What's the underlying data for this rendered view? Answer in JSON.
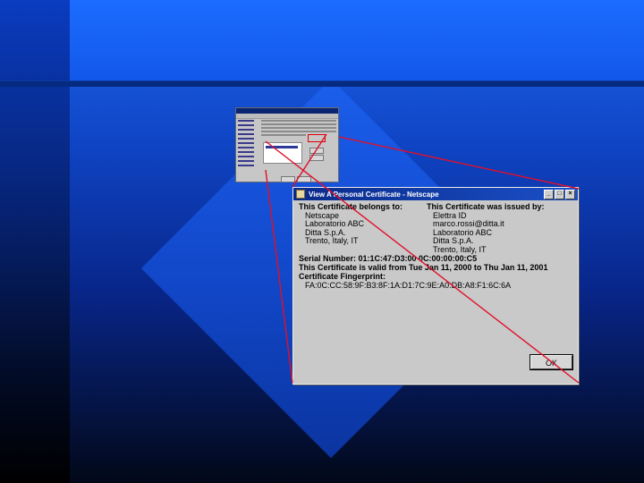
{
  "colors": {
    "accent_line": "#e0102a",
    "titlebar": "#0a2a8a",
    "dialog_bg": "#c9c9c9"
  },
  "dialog": {
    "title": "View A Personal Certificate - Netscape",
    "belongs_heading": "This Certificate belongs to:",
    "belongs_lines": [
      "Netscape",
      "Laboratorio ABC",
      "Ditta S.p.A.",
      "Trento, Italy, IT"
    ],
    "issued_heading": "This Certificate was issued by:",
    "issued_lines": [
      "Elettra ID",
      "marco.rossi@ditta.it",
      "Laboratorio ABC",
      "Ditta S.p.A.",
      "Trento, Italy, IT"
    ],
    "serial": "Serial Number: 01:1C:47:D3:00 0C:00:00:00:C5",
    "validity": "This Certificate is valid from Tue Jan 11, 2000 to Thu Jan 11, 2001",
    "fingerprint_label": "Certificate Fingerprint:",
    "fingerprint": "FA:0C:CC:58:9F:B3:8F:1A:D1:7C:9E:A0:DB:A8:F1:6C:6A",
    "ok_label": "OK"
  }
}
